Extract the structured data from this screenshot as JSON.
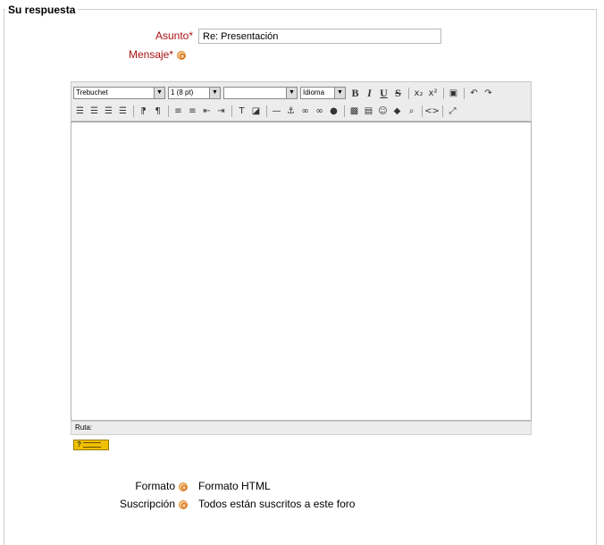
{
  "section": {
    "legend": "Su respuesta"
  },
  "subject": {
    "label": "Asunto",
    "required_mark": "*",
    "value": "Re: Presentación"
  },
  "message": {
    "label": "Mensaje",
    "required_mark": "*"
  },
  "editor": {
    "font_select": "Trebuchet",
    "size_select": "1 (8 pt)",
    "style_select": "",
    "language_select": "Idioma",
    "bold_label": "B",
    "italic_label": "I",
    "underline_label": "U",
    "strike_label": "S",
    "subscript_label": "x₂",
    "superscript_label": "x²",
    "path_label": "Ruta:"
  },
  "help_badge": {
    "label": "?"
  },
  "format": {
    "label": "Formato",
    "value": "Formato HTML"
  },
  "subscription": {
    "label": "Suscripción",
    "value": "Todos están suscritos a este foro"
  }
}
